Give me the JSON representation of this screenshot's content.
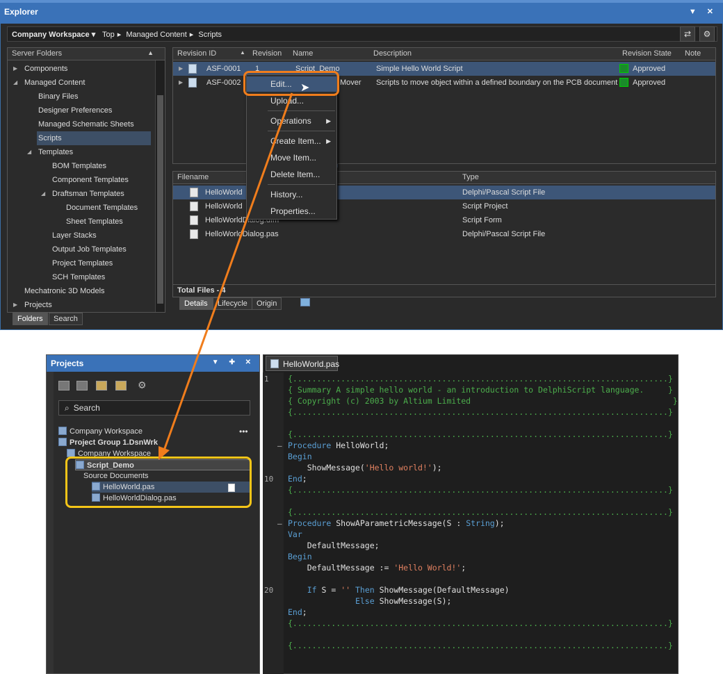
{
  "explorer": {
    "title": "Explorer",
    "workspace": "Company Workspace",
    "breadcrumb": [
      "Top",
      "Managed Content",
      "Scripts"
    ],
    "server_folders_header": "Server Folders",
    "folders": [
      {
        "label": "Components",
        "level": 0,
        "arrow": "▶"
      },
      {
        "label": "Managed Content",
        "level": 0,
        "arrow": "◢"
      },
      {
        "label": "Binary Files",
        "level": 1
      },
      {
        "label": "Designer Preferences",
        "level": 1
      },
      {
        "label": "Managed Schematic Sheets",
        "level": 1
      },
      {
        "label": "Scripts",
        "level": 1,
        "selected": true
      },
      {
        "label": "Templates",
        "level": 1,
        "arrow": "◢"
      },
      {
        "label": "BOM Templates",
        "level": 2
      },
      {
        "label": "Component Templates",
        "level": 2
      },
      {
        "label": "Draftsman Templates",
        "level": 2,
        "arrow": "◢"
      },
      {
        "label": "Document Templates",
        "level": 3
      },
      {
        "label": "Sheet Templates",
        "level": 3
      },
      {
        "label": "Layer Stacks",
        "level": 2
      },
      {
        "label": "Output Job Templates",
        "level": 2
      },
      {
        "label": "Project Templates",
        "level": 2
      },
      {
        "label": "SCH Templates",
        "level": 2
      },
      {
        "label": "Mechatronic 3D Models",
        "level": 0
      },
      {
        "label": "Projects",
        "level": 0,
        "arrow": "▶"
      }
    ],
    "left_tabs": [
      "Folders",
      "Search"
    ],
    "columns": [
      "Revision ID",
      "Revision",
      "Name",
      "Description",
      "Revision State",
      "Note"
    ],
    "items": [
      {
        "id": "ASF-0001",
        "revision": "1",
        "name": "Script_Demo",
        "description": "Simple Hello World Script",
        "state": "Approved"
      },
      {
        "id": "ASF-0002",
        "revision": "",
        "name": "Mover",
        "description": "Scripts to move object within a defined boundary on the PCB document",
        "state": "Approved"
      }
    ],
    "file_columns": [
      "Filename",
      "Type"
    ],
    "files": [
      {
        "name": "HelloWorld",
        "type": "Delphi/Pascal Script File"
      },
      {
        "name": "HelloWorld",
        "type": "Script Project"
      },
      {
        "name": "HelloWorldDialog.dfm",
        "type": "Script Form"
      },
      {
        "name": "HelloWorldDialog.pas",
        "type": "Delphi/Pascal Script File"
      }
    ],
    "total_files": "Total Files - 4",
    "bottom_tabs": [
      "Details",
      "Lifecycle",
      "Origin"
    ],
    "context_menu": [
      {
        "label": "Edit...",
        "highlighted": true
      },
      {
        "label": "Upload..."
      },
      {
        "label": "Operations",
        "submenu": true
      },
      {
        "label": "Create Item...",
        "submenu": true
      },
      {
        "label": "Move Item..."
      },
      {
        "label": "Delete Item..."
      },
      {
        "label": "History..."
      },
      {
        "label": "Properties..."
      }
    ]
  },
  "projects": {
    "title": "Projects",
    "search_placeholder": "Search",
    "tree": [
      {
        "label": "Company Workspace",
        "bold": false
      },
      {
        "label": "Project Group 1.DsnWrk",
        "bold": true
      },
      {
        "label": "Company Workspace",
        "bold": false
      },
      {
        "label": "Script_Demo",
        "bold": true
      },
      {
        "label": "Source Documents",
        "bold": false
      },
      {
        "label": "HelloWorld.pas",
        "bold": false,
        "selected": true
      },
      {
        "label": "HelloWorldDialog.pas",
        "bold": false
      }
    ]
  },
  "editor": {
    "tab": "HelloWorld.pas",
    "line_numbers": [
      "1",
      "10",
      "20"
    ],
    "lines": [
      [
        {
          "t": "cmt",
          "v": "{..............................................................................}"
        }
      ],
      [
        {
          "t": "cmt",
          "v": "{ Summary A simple hello world - an introduction to DelphiScript language.     }"
        }
      ],
      [
        {
          "t": "cmt",
          "v": "{ Copyright (c) 2003 by Altium Limited                                          }"
        }
      ],
      [
        {
          "t": "cmt",
          "v": "{..............................................................................}"
        }
      ],
      [],
      [
        {
          "t": "cmt",
          "v": "{..............................................................................}"
        }
      ],
      [
        {
          "t": "kw",
          "v": "Procedure"
        },
        {
          "t": "plain",
          "v": " HelloWorld;"
        }
      ],
      [
        {
          "t": "kw",
          "v": "Begin"
        }
      ],
      [
        {
          "t": "plain",
          "v": "    ShowMessage("
        },
        {
          "t": "str",
          "v": "'Hello world!'"
        },
        {
          "t": "plain",
          "v": ");"
        }
      ],
      [
        {
          "t": "kw",
          "v": "End"
        },
        {
          "t": "plain",
          "v": ";"
        }
      ],
      [
        {
          "t": "cmt",
          "v": "{..............................................................................}"
        }
      ],
      [],
      [
        {
          "t": "cmt",
          "v": "{..............................................................................}"
        }
      ],
      [
        {
          "t": "kw",
          "v": "Procedure"
        },
        {
          "t": "plain",
          "v": " ShowAParametricMessage(S : "
        },
        {
          "t": "kw",
          "v": "String"
        },
        {
          "t": "plain",
          "v": ");"
        }
      ],
      [
        {
          "t": "kw",
          "v": "Var"
        }
      ],
      [
        {
          "t": "plain",
          "v": "    DefaultMessage;"
        }
      ],
      [
        {
          "t": "kw",
          "v": "Begin"
        }
      ],
      [
        {
          "t": "plain",
          "v": "    DefaultMessage := "
        },
        {
          "t": "str",
          "v": "'Hello World!'"
        },
        {
          "t": "plain",
          "v": ";"
        }
      ],
      [],
      [
        {
          "t": "plain",
          "v": "    "
        },
        {
          "t": "kw",
          "v": "If"
        },
        {
          "t": "plain",
          "v": " S = "
        },
        {
          "t": "str",
          "v": "''"
        },
        {
          "t": "plain",
          "v": " "
        },
        {
          "t": "kw",
          "v": "Then"
        },
        {
          "t": "plain",
          "v": " ShowMessage(DefaultMessage)"
        }
      ],
      [
        {
          "t": "plain",
          "v": "              "
        },
        {
          "t": "kw",
          "v": "Else"
        },
        {
          "t": "plain",
          "v": " ShowMessage(S);"
        }
      ],
      [
        {
          "t": "kw",
          "v": "End"
        },
        {
          "t": "plain",
          "v": ";"
        }
      ],
      [
        {
          "t": "cmt",
          "v": "{..............................................................................}"
        }
      ],
      [],
      [
        {
          "t": "cmt",
          "v": "{..............................................................................}"
        }
      ]
    ]
  }
}
